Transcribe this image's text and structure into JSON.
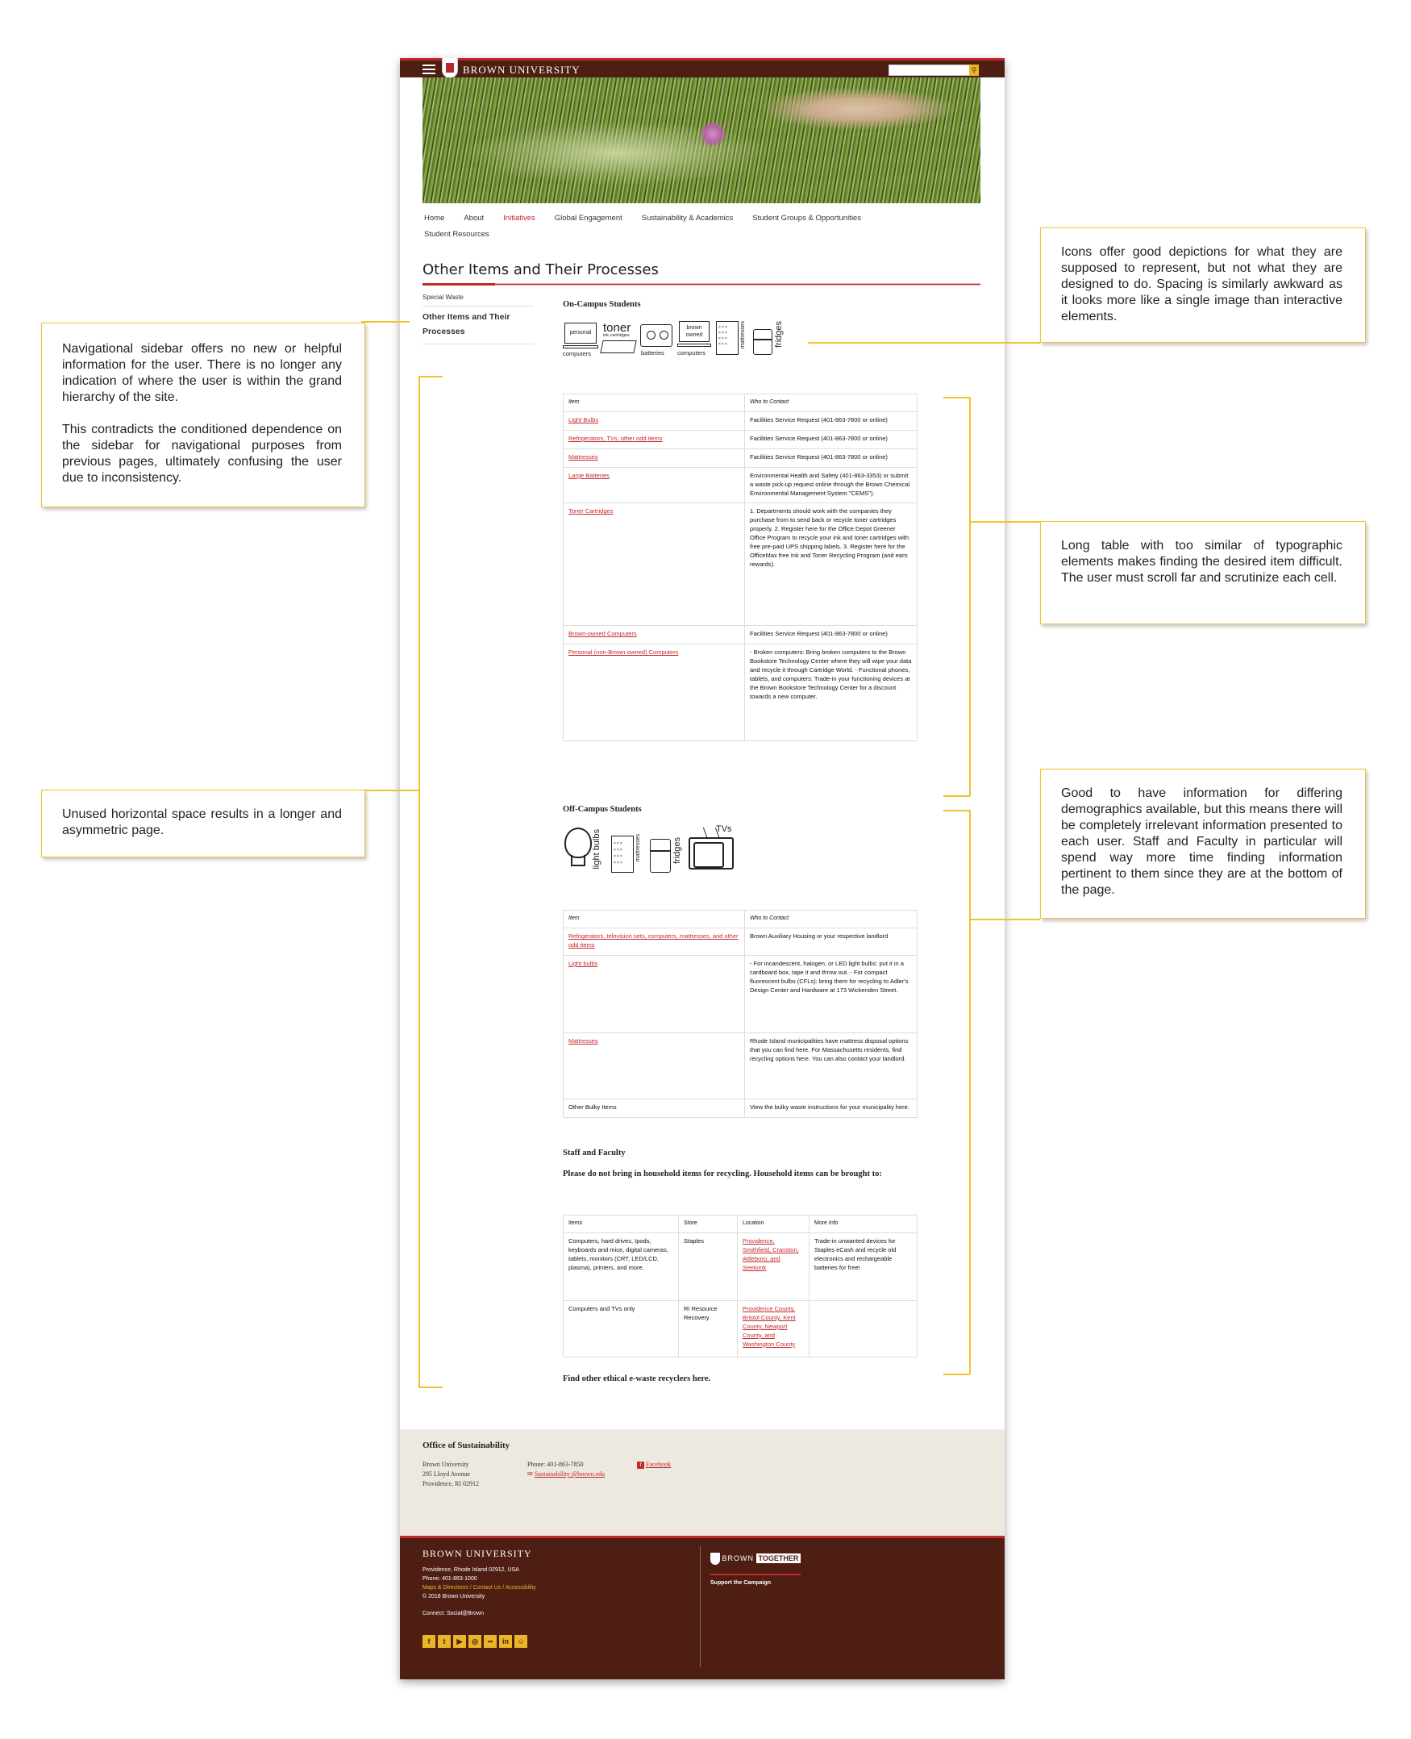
{
  "site": {
    "brand": "BROWN UNIVERSITY",
    "nav": [
      "Home",
      "About",
      "Initiatives",
      "Global Engagement",
      "Sustainability & Academics",
      "Student Groups & Opportunities",
      "Student Resources"
    ],
    "active_nav": "Initiatives"
  },
  "page": {
    "title": "Other Items and Their Processes",
    "sidebar": [
      "Special Waste",
      "Other Items and Their Processes"
    ]
  },
  "on_campus": {
    "heading": "On-Campus Students",
    "icons": [
      "personal computers",
      "toner ink cartridges",
      "batteries",
      "brown owned computers",
      "mattresses",
      "fridges"
    ],
    "table_headers": [
      "Item",
      "Who to Contact"
    ],
    "rows": [
      {
        "item": "Light Bulbs",
        "contact": "Facilities Service Request (401-863-7800 or online)"
      },
      {
        "item": "Refrigerators, TVs, other odd items",
        "contact": "Facilities Service Request (401-863-7800 or online)"
      },
      {
        "item": "Mattresses",
        "contact": "Facilities Service Request (401-863-7800 or online)"
      },
      {
        "item": "Large Batteries",
        "contact": "Environmental Health and Safety (401-863-3353) or submit a waste pick-up request online through the Brown Chemical Environmental Management System \"CEMS\")."
      },
      {
        "item": "Toner Cartridges",
        "contact": "1. Departments should work with the companies they purchase from to send back or recycle toner cartridges properly. 2. Register here for the Office Depot Greener Office Program to recycle your ink and toner cartridges with free pre-paid UPS shipping labels. 3. Register here for the OfficeMax free Ink and Toner Recycling Program (and earn rewards)."
      },
      {
        "item": "Brown-owned Computers",
        "contact": "Facilities Service Request (401-863-7800 or online)"
      },
      {
        "item": "Personal (non-Brown-owned) Computers",
        "contact": "- Broken computers: Bring broken computers to the Brown Bookstore Technology Center where they will wipe your data and recycle it through Cartridge World. - Functional phones, tablets, and computers: Trade-in your functioning devices at the Brown Bookstore Technology Center for a discount towards a new computer."
      }
    ]
  },
  "off_campus": {
    "heading": "Off-Campus Students",
    "icons": [
      "light bulbs",
      "mattresses",
      "fridges",
      "TVs"
    ],
    "table_headers": [
      "Item",
      "Who to Contact"
    ],
    "rows": [
      {
        "item": "Refrigerators, television sets, computers, mattresses, and other odd items",
        "contact": "Brown Auxiliary Housing or your respective landlord"
      },
      {
        "item": "Light bulbs",
        "contact": "- For incandescent, halogen, or LED light bulbs: put it in a cardboard box, tape it and throw out. - For compact fluorescent bulbs (CFLs): bring them for recycling to Adler's Design Center and Hardware at 173 Wickenden Street."
      },
      {
        "item": "Mattresses",
        "contact": "Rhode Island municipalities have mattress disposal options that you can find here. For Massachusetts residents, find recycling options here. You can also contact your landlord."
      },
      {
        "item": "Other Bulky Items",
        "contact": "View the bulky waste instructions for your municipality here."
      }
    ]
  },
  "staff": {
    "heading": "Staff and Faculty",
    "intro": "Please do not bring in household items for recycling. Household items can be brought to:",
    "table_headers": [
      "Items",
      "Store",
      "Location",
      "More Info"
    ],
    "rows": [
      {
        "items": "Computers, hard drives, Ipods, keyboards and mice, digital cameras, tablets, monitors (CRT, LED/LCD, plasma), printers, and more.",
        "store": "Staples",
        "location": "Providence, Smithfield, Cranston, Attleboro, and Seekonk",
        "info": "Trade-in unwanted devices for Staples eCash and recycle old electronics and rechargeable batteries for free!"
      },
      {
        "items": "Computers and TVs only",
        "store": "RI Resource Recovery",
        "location": "Providence County, Bristol County, Kent County, Newport County, and Washington County",
        "info": ""
      }
    ],
    "find_other": "Find other ethical e-waste recyclers here."
  },
  "footer": {
    "office_title": "Office of Sustainability",
    "address": [
      "Brown University",
      "295 Lloyd Avenue",
      "Providence, RI 02912"
    ],
    "phone": "Phone: 401-863-7850",
    "email": "Sustainability @brown.edu",
    "facebook": "Facebook",
    "bottom_title": "BROWN UNIVERSITY",
    "bottom_lines": [
      "Providence, Rhode Island 02912, USA",
      "Phone: 401-863-1000"
    ],
    "links": "Maps & Directions / Contact Us / Accessibility",
    "copyright": "© 2018 Brown University",
    "connect": "Connect: Social@Brown",
    "campaign_brand": "BROWN",
    "campaign_tag": "TOGETHER",
    "campaign_link": "Support the Campaign"
  },
  "annotations": {
    "sidebar_note": [
      "Navigational sidebar offers no new or helpful information for the user. There is no longer any indication of where the user is within the grand hierarchy of the site.",
      "This contradicts the conditioned dependence on the sidebar for navigational purposes from previous pages, ultimately confusing the user due to inconsistency."
    ],
    "space_note": "Unused horizontal space results in a longer and asymmetric page.",
    "icons_note": "Icons offer good depictions for what they are supposed to represent, but not what they are designed to do. Spacing is similarly awkward as it looks more like a single image than interactive elements.",
    "table_note": "Long table with too similar of typographic elements makes finding the desired item difficult. The user must scroll far and scrutinize each cell.",
    "demographics_note": "Good to have information for differing demographics available, but this means there will be completely irrelevant information presented to each user. Staff and Faculty in particular will spend way more time finding information pertinent to them since they are at the bottom of the page."
  },
  "colors": {
    "brand_brown": "#4e1e13",
    "brand_red": "#c4282b",
    "accent_yellow": "#f2c230"
  }
}
